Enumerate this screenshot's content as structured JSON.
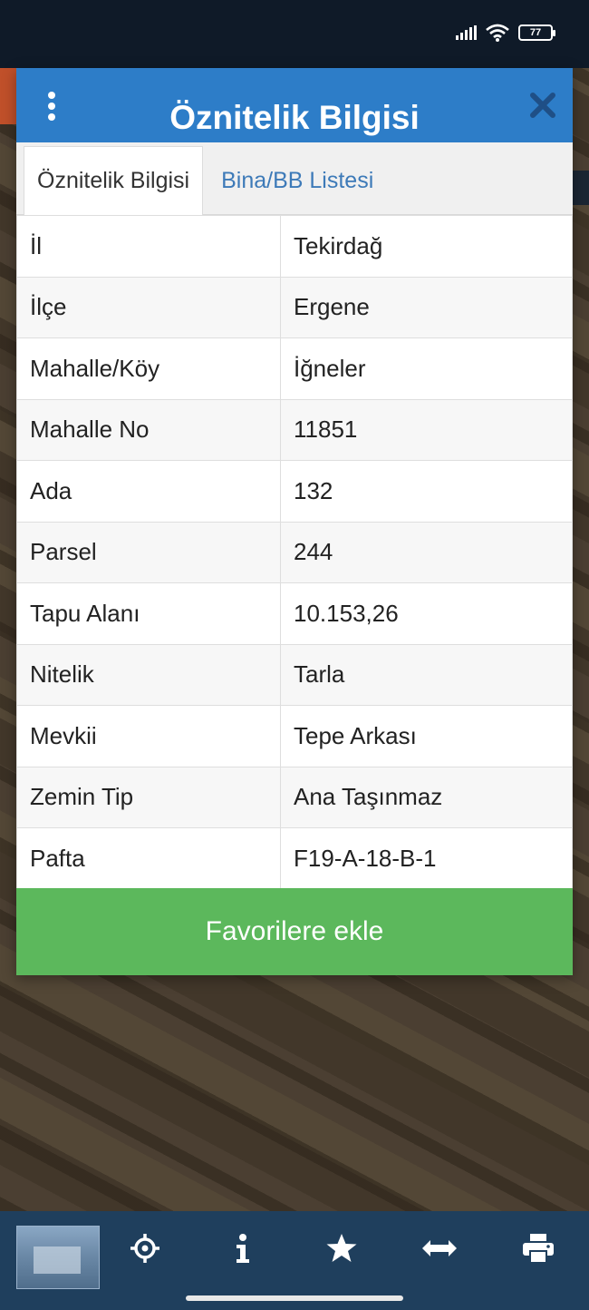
{
  "status_bar": {
    "battery": "77"
  },
  "dialog": {
    "title": "Öznitelik Bilgisi",
    "tabs": [
      {
        "label": "Öznitelik Bilgisi",
        "active": true
      },
      {
        "label": "Bina/BB Listesi",
        "active": false
      }
    ],
    "rows": [
      {
        "key": "İl",
        "value": "Tekirdağ"
      },
      {
        "key": "İlçe",
        "value": "Ergene"
      },
      {
        "key": "Mahalle/Köy",
        "value": "İğneler"
      },
      {
        "key": "Mahalle No",
        "value": "11851"
      },
      {
        "key": "Ada",
        "value": "132"
      },
      {
        "key": "Parsel",
        "value": "244"
      },
      {
        "key": "Tapu Alanı",
        "value": "10.153,26"
      },
      {
        "key": "Nitelik",
        "value": "Tarla"
      },
      {
        "key": "Mevkii",
        "value": "Tepe Arkası"
      },
      {
        "key": "Zemin Tip",
        "value": "Ana Taşınmaz"
      },
      {
        "key": "Pafta",
        "value": "F19-A-18-B-1"
      }
    ],
    "favorite_button": "Favorilere ekle"
  },
  "toolbar": {
    "items": [
      "map-thumbnail",
      "locate-icon",
      "info-icon",
      "star-icon",
      "measure-icon",
      "print-icon"
    ]
  },
  "colors": {
    "header": "#2d7dc8",
    "button_green": "#5cb85c",
    "toolbar": "#1f3f5d",
    "tab_link": "#3d7ab8"
  }
}
